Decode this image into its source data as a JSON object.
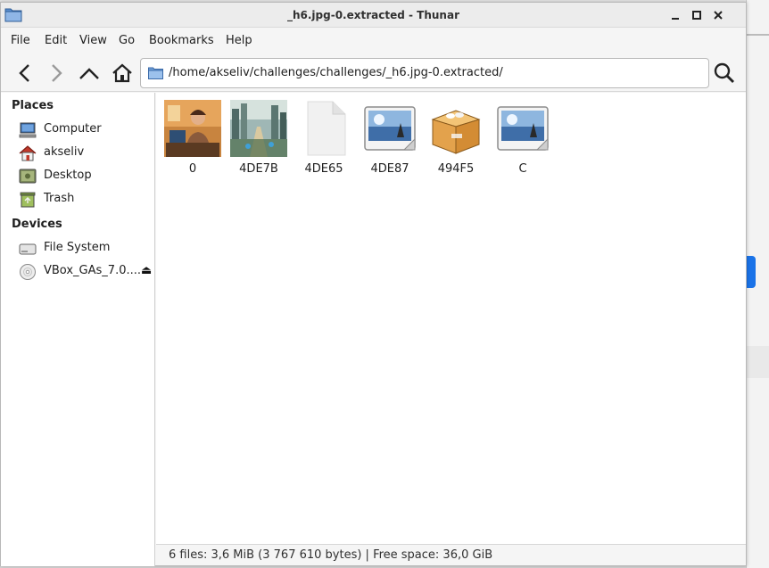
{
  "window": {
    "title": "_h6.jpg-0.extracted - Thunar"
  },
  "controls": {
    "minimize": "_",
    "maximize": "□",
    "close": "×"
  },
  "menu": [
    "File",
    "Edit",
    "View",
    "Go",
    "Bookmarks",
    "Help"
  ],
  "toolbar": {
    "back_icon": "back-arrow-icon",
    "forward_icon": "forward-arrow-icon",
    "up_icon": "up-arrow-icon",
    "home_icon": "home-icon",
    "search_icon": "search-icon"
  },
  "location": {
    "path": "/home/akseliv/challenges/challenges/_h6.jpg-0.extracted/"
  },
  "sidebar": {
    "places_heading": "Places",
    "places": [
      {
        "label": "Computer",
        "icon": "computer-icon"
      },
      {
        "label": "akseliv",
        "icon": "home-folder-icon"
      },
      {
        "label": "Desktop",
        "icon": "desktop-icon"
      },
      {
        "label": "Trash",
        "icon": "trash-icon"
      }
    ],
    "devices_heading": "Devices",
    "devices": [
      {
        "label": "File System",
        "icon": "drive-icon"
      },
      {
        "label": "VBox_GAs_7.0....",
        "icon": "optical-disc-icon",
        "eject": "⏏"
      }
    ]
  },
  "files": [
    {
      "name": "0",
      "type": "image-thumbnail-person"
    },
    {
      "name": "4DE7B",
      "type": "image-thumbnail-city"
    },
    {
      "name": "4DE65",
      "type": "blank-document"
    },
    {
      "name": "4DE87",
      "type": "image-file"
    },
    {
      "name": "494F5",
      "type": "package-archive"
    },
    {
      "name": "C",
      "type": "image-file"
    }
  ],
  "status": {
    "text": "6 files: 3,6 MiB (3 767 610 bytes)  |  Free space: 36,0 GiB"
  }
}
